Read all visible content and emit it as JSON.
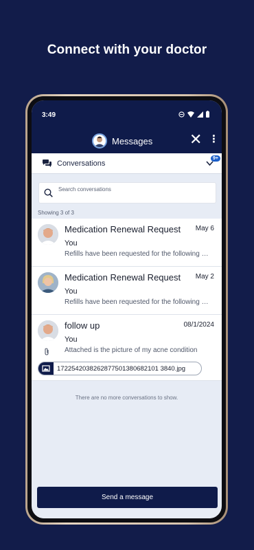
{
  "headline": "Connect with your doctor",
  "status_bar": {
    "time": "3:49"
  },
  "appbar": {
    "title": "Messages"
  },
  "conversations_bar": {
    "label": "Conversations",
    "badge": "9+"
  },
  "search": {
    "placeholder": "Search conversations",
    "value": ""
  },
  "showing_text": "Showing 3 of 3",
  "conversations": [
    {
      "subject": "Medication Renewal Request",
      "date": "May 6",
      "sender": "You",
      "preview": "Refills have been requested for the following medications",
      "avatar": "doctor-male-avatar"
    },
    {
      "subject": "Medication Renewal Request",
      "date": "May 2",
      "sender": "You",
      "preview": "Refills have been requested for the following medications",
      "avatar": "doctor-female-avatar"
    },
    {
      "subject": "follow up",
      "date": "08/1/2024",
      "sender": "You",
      "preview": "Attached is the picture of my acne condition",
      "avatar": "doctor-male-avatar",
      "attachment": "1722542038262877501380682101 3840.jpg"
    }
  ],
  "end_text": "There are no more conversations to show.",
  "send_button": "Send a message",
  "colors": {
    "navy": "#0f1b4a",
    "background": "#121c4a",
    "badge": "#1c5fc9"
  }
}
